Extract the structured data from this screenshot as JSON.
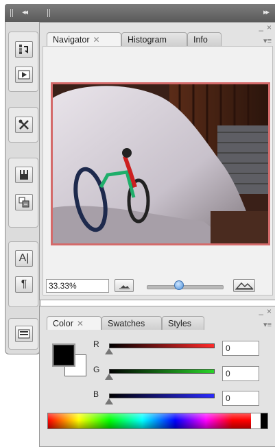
{
  "toolbar_top": {
    "collapse_glyph": "◂◂",
    "expand_glyph": "▸▸",
    "grip_icon": "grip-icon"
  },
  "tool_dock": {
    "items": [
      {
        "name": "history-icon",
        "glyph": "↻"
      },
      {
        "name": "actions-play-icon",
        "glyph": "▶"
      },
      {
        "name": "tools-icon",
        "glyph": "✂"
      },
      {
        "name": "brushes-icon",
        "glyph": "✎"
      },
      {
        "name": "clone-source-icon",
        "glyph": "⎘"
      },
      {
        "name": "character-icon",
        "glyph": "A|"
      },
      {
        "name": "paragraph-icon",
        "glyph": "¶"
      },
      {
        "name": "layer-comps-icon",
        "glyph": "▤"
      }
    ]
  },
  "navigator_panel": {
    "tabs": [
      {
        "label": "Navigator",
        "active": true,
        "closable": true
      },
      {
        "label": "Histogram",
        "active": false
      },
      {
        "label": "Info",
        "active": false
      }
    ],
    "zoom_value": "33.33%",
    "zoom_level": 0.42,
    "view_box_color": "#d46a6a"
  },
  "color_panel": {
    "tabs": [
      {
        "label": "Color",
        "active": true,
        "closable": true
      },
      {
        "label": "Swatches",
        "active": false
      },
      {
        "label": "Styles",
        "active": false
      }
    ],
    "foreground": "#000000",
    "background": "#ffffff",
    "sliders": [
      {
        "label": "R",
        "value": "0",
        "ramp_color": "#ff2a2a"
      },
      {
        "label": "G",
        "value": "0",
        "ramp_color": "#2ad52a"
      },
      {
        "label": "B",
        "value": "0",
        "ramp_color": "#2a2aff"
      }
    ]
  },
  "panel_controls": {
    "minimize": "–",
    "close": "×",
    "menu": "▾≡"
  }
}
